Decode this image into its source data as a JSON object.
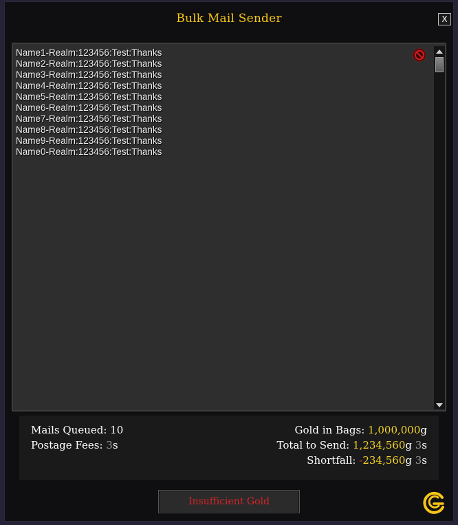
{
  "window": {
    "title": "Bulk Mail Sender",
    "close_label": "X"
  },
  "mail_list": {
    "lines": [
      "Name1-Realm:123456:Test:Thanks",
      "Name2-Realm:123456:Test:Thanks",
      "Name3-Realm:123456:Test:Thanks",
      "Name4-Realm:123456:Test:Thanks",
      "Name5-Realm:123456:Test:Thanks",
      "Name6-Realm:123456:Test:Thanks",
      "Name7-Realm:123456:Test:Thanks",
      "Name8-Realm:123456:Test:Thanks",
      "Name9-Realm:123456:Test:Thanks",
      "Name0-Realm:123456:Test:Thanks"
    ]
  },
  "summary": {
    "mails_queued_label": "Mails Queued: ",
    "mails_queued_value": "10",
    "postage_label": "Postage Fees: ",
    "postage_silver": "3",
    "gold_in_bags_label": "Gold in Bags: ",
    "gold_in_bags_value": "1,000,000",
    "total_label": "Total to Send: ",
    "total_gold": "1,234,560",
    "total_silver": "3",
    "shortfall_label": "Shortfall: ",
    "shortfall_sign": "-",
    "shortfall_gold": "234,560",
    "shortfall_silver": "3",
    "gold_unit": "g",
    "silver_unit": "s"
  },
  "action": {
    "button_label": "Insufficient Gold"
  },
  "icons": {
    "clear": "clear-list-icon",
    "logo": "addon-logo-icon",
    "scroll_up": "scroll-up-arrow-icon",
    "scroll_down": "scroll-down-arrow-icon"
  },
  "colors": {
    "title": "#f5c518",
    "gold": "#f5d42a",
    "silver": "#9a9a9a",
    "error": "#d7242a"
  }
}
